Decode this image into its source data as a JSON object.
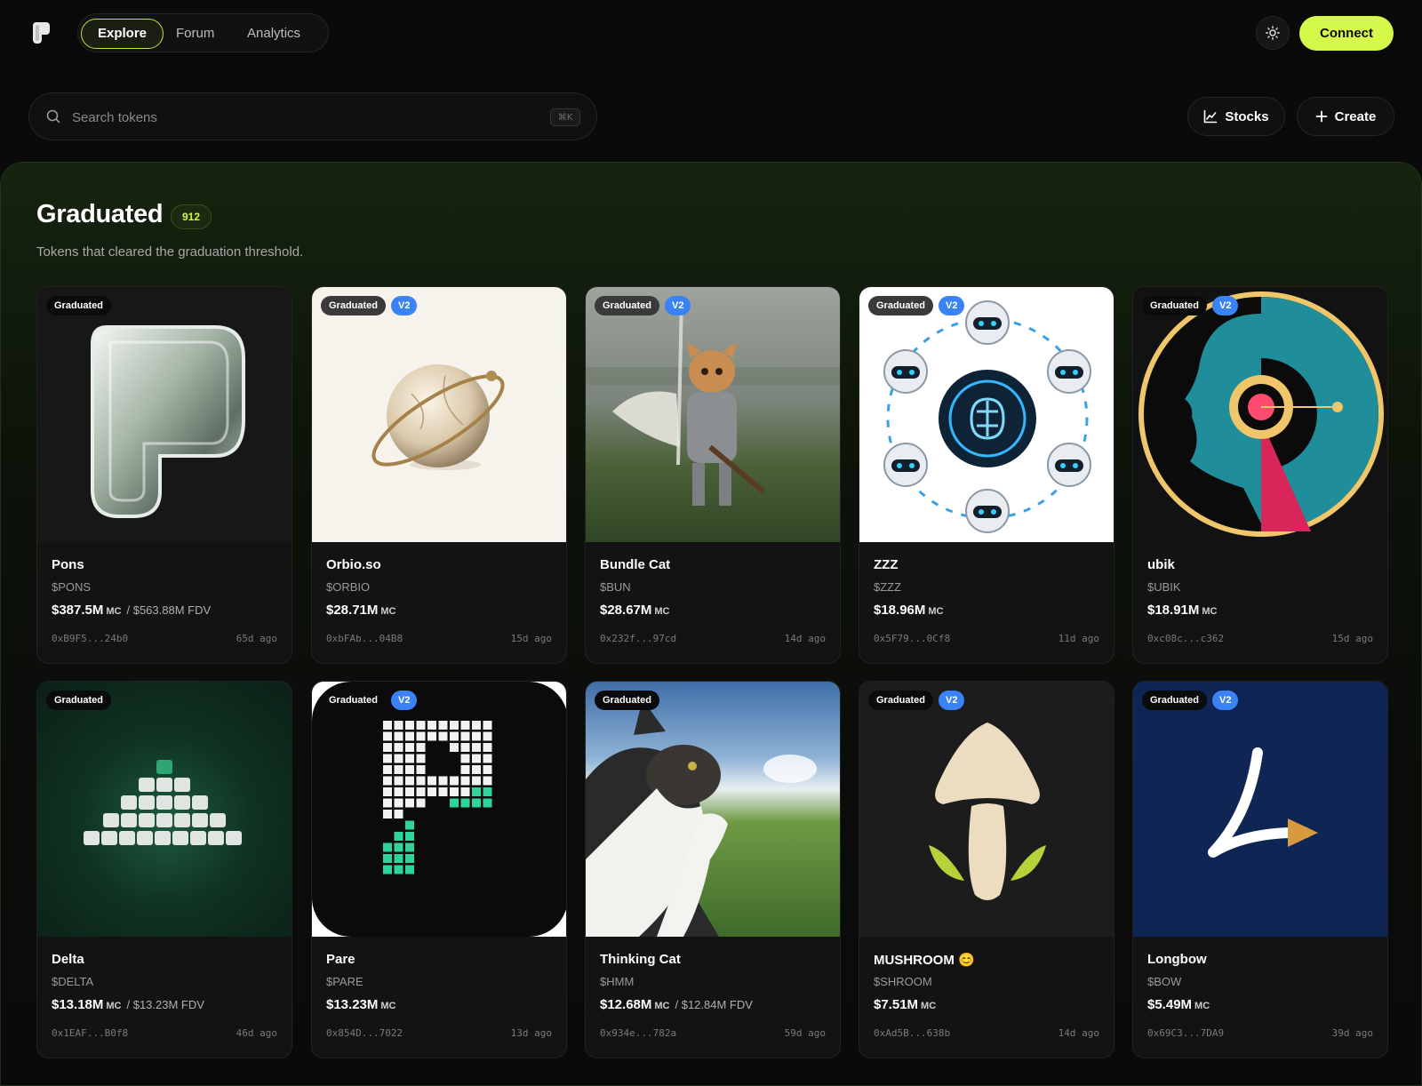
{
  "nav": {
    "tabs": [
      {
        "label": "Explore",
        "active": true
      },
      {
        "label": "Forum",
        "active": false
      },
      {
        "label": "Analytics",
        "active": false
      }
    ],
    "connect_label": "Connect",
    "theme_icon": "sun-icon"
  },
  "search": {
    "placeholder": "Search tokens",
    "shortcut": "⌘K",
    "stocks_label": "Stocks",
    "create_label": "Create"
  },
  "section": {
    "title": "Graduated",
    "count": "912",
    "subtitle": "Tokens that cleared the graduation threshold."
  },
  "colors": {
    "accent": "#d4f94a",
    "v2_badge": "#3b82f6",
    "background": "#0a0a0a"
  },
  "cards": [
    {
      "name": "Pons",
      "ticker": "$PONS",
      "mc": "$387.5M",
      "mc_unit": "MC",
      "fdv": "/ $563.88M FDV",
      "address": "0xB9F5...24b0",
      "age": "65d ago",
      "badge": "Graduated",
      "v2": ""
    },
    {
      "name": "Orbio.so",
      "ticker": "$ORBIO",
      "mc": "$28.71M",
      "mc_unit": "MC",
      "fdv": "",
      "address": "0xbFAb...04B8",
      "age": "15d ago",
      "badge": "Graduated",
      "v2": "V2"
    },
    {
      "name": "Bundle Cat",
      "ticker": "$BUN",
      "mc": "$28.67M",
      "mc_unit": "MC",
      "fdv": "",
      "address": "0x232f...97cd",
      "age": "14d ago",
      "badge": "Graduated",
      "v2": "V2"
    },
    {
      "name": "ZZZ",
      "ticker": "$ZZZ",
      "mc": "$18.96M",
      "mc_unit": "MC",
      "fdv": "",
      "address": "0x5F79...0Cf8",
      "age": "11d ago",
      "badge": "Graduated",
      "v2": "V2"
    },
    {
      "name": "ubik",
      "ticker": "$UBIK",
      "mc": "$18.91M",
      "mc_unit": "MC",
      "fdv": "",
      "address": "0xc08c...c362",
      "age": "15d ago",
      "badge": "Graduated",
      "v2": "V2"
    },
    {
      "name": "Delta",
      "ticker": "$DELTA",
      "mc": "$13.18M",
      "mc_unit": "MC",
      "fdv": "/ $13.23M FDV",
      "address": "0x1EAF...B0f8",
      "age": "46d ago",
      "badge": "Graduated",
      "v2": ""
    },
    {
      "name": "Pare",
      "ticker": "$PARE",
      "mc": "$13.23M",
      "mc_unit": "MC",
      "fdv": "",
      "address": "0x854D...7022",
      "age": "13d ago",
      "badge": "Graduated",
      "v2": "V2"
    },
    {
      "name": "Thinking Cat",
      "ticker": "$HMM",
      "mc": "$12.68M",
      "mc_unit": "MC",
      "fdv": "/ $12.84M FDV",
      "address": "0x934e...782a",
      "age": "59d ago",
      "badge": "Graduated",
      "v2": ""
    },
    {
      "name": "MUSHROOM 😊",
      "ticker": "$SHROOM",
      "mc": "$7.51M",
      "mc_unit": "MC",
      "fdv": "",
      "address": "0xAd5B...638b",
      "age": "14d ago",
      "badge": "Graduated",
      "v2": "V2"
    },
    {
      "name": "Longbow",
      "ticker": "$BOW",
      "mc": "$5.49M",
      "mc_unit": "MC",
      "fdv": "",
      "address": "0x69C3...7DA9",
      "age": "39d ago",
      "badge": "Graduated",
      "v2": "V2"
    }
  ]
}
